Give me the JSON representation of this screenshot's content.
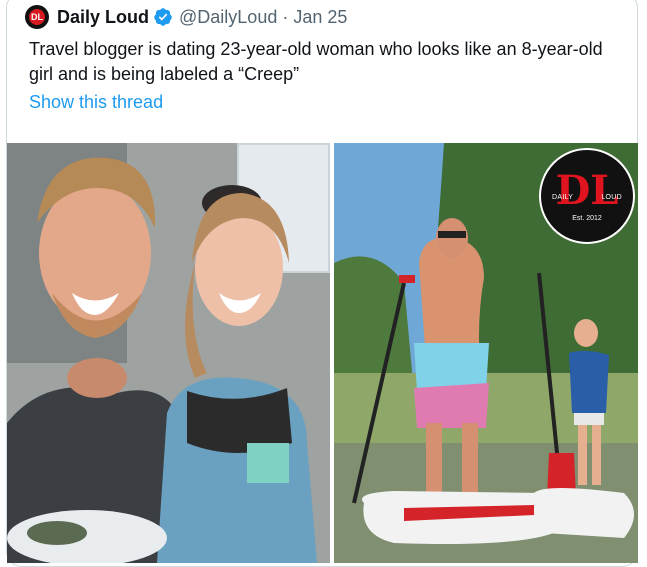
{
  "tweet": {
    "author_name": "Daily Loud",
    "handle": "@DailyLoud",
    "separator": "·",
    "date": "Jan 25",
    "avatar_letter": "DL",
    "text": "Travel blogger is dating 23-year-old woman who looks like an 8-year-old girl and is being labeled a “Creep”",
    "show_thread": "Show this thread"
  },
  "media": {
    "logo": {
      "left": "DAILY",
      "right": "LOUD",
      "mark": "DL",
      "est": "Est. 2012"
    }
  },
  "colors": {
    "link": "#1d9bf0",
    "secondary_text": "#536471",
    "verified": "#1d9bf0",
    "brand_red": "#d71920"
  },
  "icons": [
    "verified-badge-icon"
  ]
}
